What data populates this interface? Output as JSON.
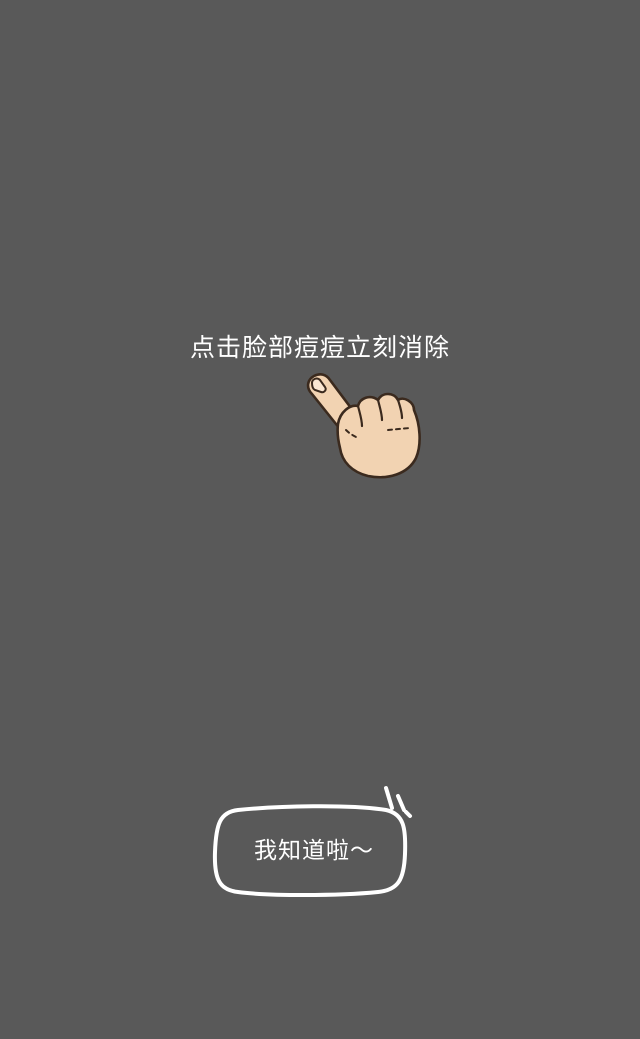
{
  "overlay": {
    "background": "#595959",
    "hint_text": "点击脸部痘痘立刻消除",
    "pointer_icon": "pointing-hand-icon"
  },
  "dismiss": {
    "label": "我知道啦～"
  }
}
